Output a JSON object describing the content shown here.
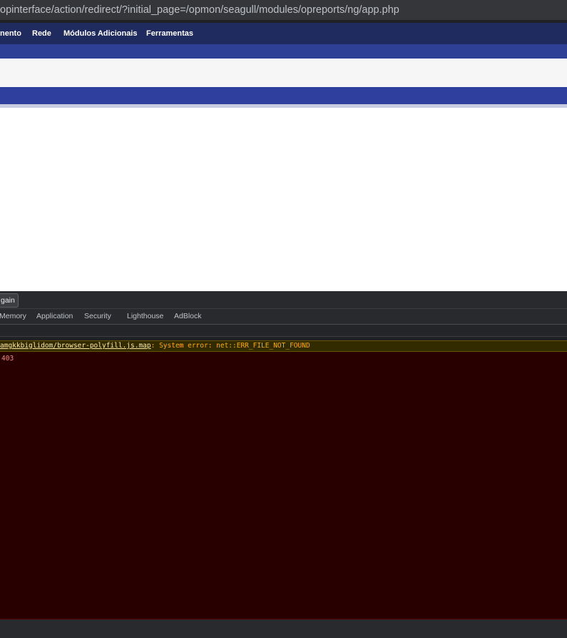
{
  "browser": {
    "url": "opinterface/action/redirect/?initial_page=/opmon/seagull/modules/opreports/ng/app.php"
  },
  "page": {
    "nav_items": [
      {
        "label": "nento"
      },
      {
        "label": "Rede"
      },
      {
        "label": "Módulos Adicionais"
      },
      {
        "label": "Ferramentas"
      }
    ]
  },
  "devtools": {
    "button_label": "gain",
    "tabs": [
      {
        "label": "Memory"
      },
      {
        "label": "Application"
      },
      {
        "label": "Security"
      },
      {
        "label": "Lighthouse"
      },
      {
        "label": "AdBlock"
      }
    ],
    "console": {
      "warning_link": "amgkkbiglidom/browser-polyfill.js.map",
      "warning_text": ": System error: net::ERR_FILE_NOT_FOUND",
      "error_text": "403"
    }
  }
}
